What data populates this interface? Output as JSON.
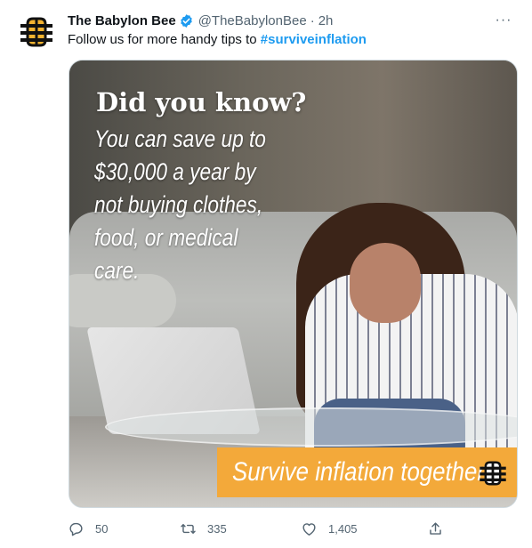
{
  "tweet": {
    "author_name": "The Babylon Bee",
    "handle": "@TheBabylonBee",
    "separator": "·",
    "time": "2h",
    "more_label": "···",
    "text_prefix": "Follow us for more handy tips to ",
    "hashtag": "#surviveinflation"
  },
  "media": {
    "headline": "Did you know?",
    "body_line1": "You can save up to",
    "body_line2": "$30,000 a year by",
    "body_line3": "not buying clothes,",
    "body_line4": "food, or medical care.",
    "banner_text": "Survive inflation together."
  },
  "actions": {
    "replies": "50",
    "retweets": "335",
    "likes": "1,405"
  },
  "colors": {
    "accent": "#1d9bf0",
    "muted": "#536471",
    "banner": "#f3a93a",
    "logo": "#f4b330"
  },
  "icons": [
    "bee-logo-icon",
    "verified-badge-icon",
    "more-icon",
    "reply-icon",
    "retweet-icon",
    "like-icon",
    "share-icon"
  ]
}
